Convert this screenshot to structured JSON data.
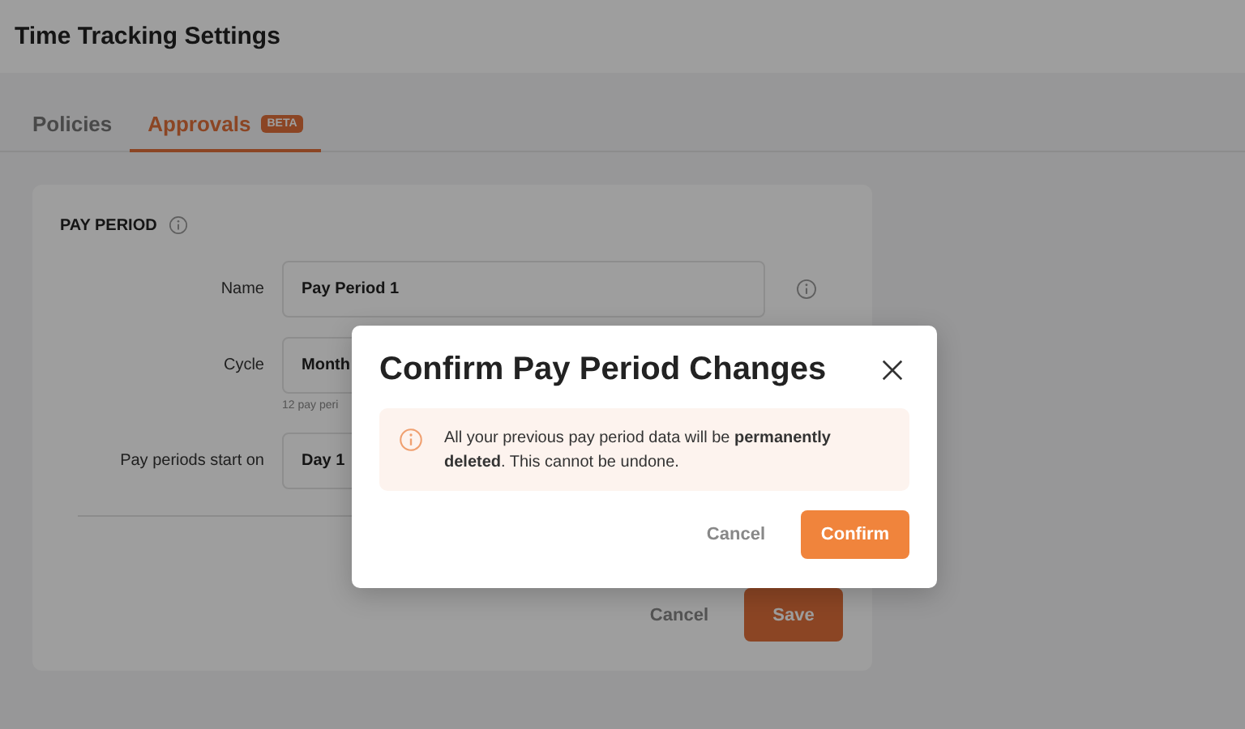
{
  "page": {
    "title": "Time Tracking Settings"
  },
  "tabs": [
    {
      "label": "Policies",
      "selected": false
    },
    {
      "label": "Approvals",
      "badge": "BETA",
      "selected": true
    }
  ],
  "section": {
    "title": "PAY PERIOD",
    "fields": [
      {
        "label": "Name",
        "value": "Pay Period 1",
        "info": true
      },
      {
        "label": "Cycle",
        "value": "Month",
        "helper": "12 pay peri",
        "info": false
      },
      {
        "label": "Pay periods start on",
        "value": "Day 1",
        "info": false
      }
    ],
    "buttons": [
      {
        "label": "Cancel",
        "kind": "secondary"
      },
      {
        "label": "Save",
        "kind": "primary"
      }
    ]
  },
  "dialog": {
    "title": "Confirm Pay Period Changes",
    "message": "All your previous pay period data will be **permanently deleted**. This cannot be undone.",
    "buttons": [
      {
        "label": "Cancel",
        "kind": "secondary"
      },
      {
        "label": "Confirm",
        "kind": "primary"
      }
    ]
  }
}
